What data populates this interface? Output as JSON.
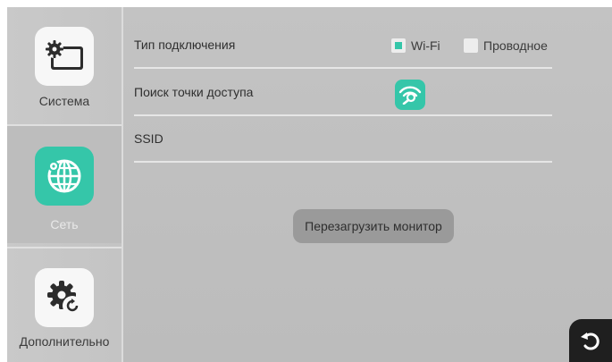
{
  "sidebar": {
    "items": [
      {
        "label": "Система",
        "icon": "settings-display-icon",
        "active": false
      },
      {
        "label": "Сеть",
        "icon": "network-globe-icon",
        "active": true
      },
      {
        "label": "Дополнительно",
        "icon": "gear-refresh-icon",
        "active": false
      }
    ]
  },
  "settings": {
    "connection_type": {
      "label": "Тип подключения",
      "options": [
        {
          "label": "Wi-Fi",
          "checked": true
        },
        {
          "label": "Проводное",
          "checked": false
        }
      ]
    },
    "access_point_search": {
      "label": "Поиск точки доступа",
      "icon": "wifi-search-icon"
    },
    "ssid": {
      "label": "SSID",
      "value": ""
    }
  },
  "actions": {
    "reboot_label": "Перезагрузить монитор",
    "back_icon": "undo-arrow-icon"
  },
  "colors": {
    "accent": "#35c6a9",
    "background": "#bdbdbd",
    "sidebar": "#c6c6c6"
  }
}
